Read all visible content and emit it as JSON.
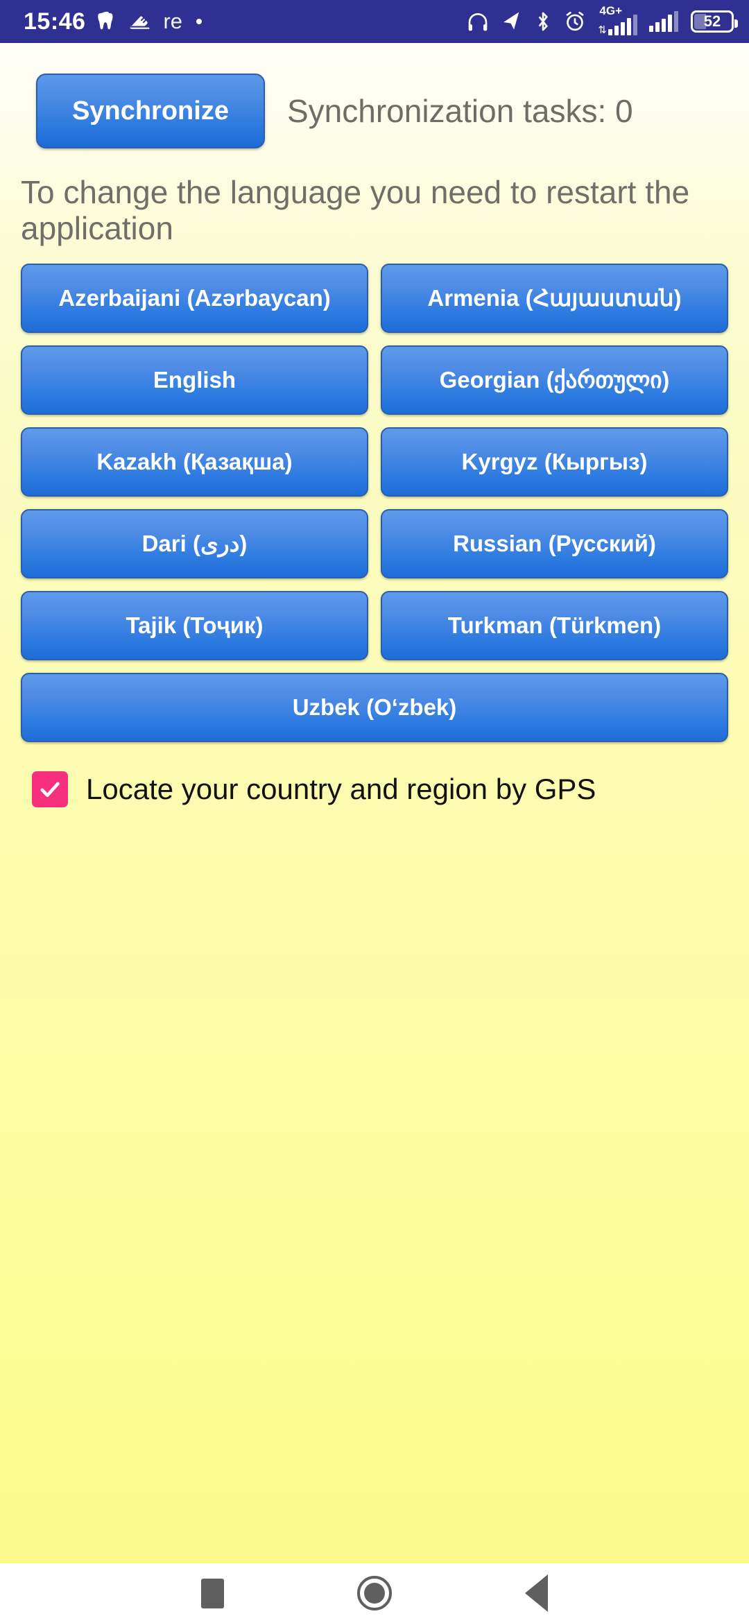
{
  "status_bar": {
    "clock": "15:46",
    "notification_text": "re",
    "left_icons": [
      "tooth-icon",
      "shoe-icon"
    ],
    "right_icons": [
      "headphones-icon",
      "location-arrow-icon",
      "bluetooth-icon",
      "alarm-clock-icon"
    ],
    "network_label": "4G+",
    "battery_level": "52",
    "background_color": "#2e3192"
  },
  "toolbar": {
    "sync_label": "Synchronize",
    "sync_tasks_text": "Synchronization tasks: 0"
  },
  "hint": {
    "text": "To change the language you need to restart the application"
  },
  "languages": {
    "items": [
      {
        "label": "Azerbaijani (Azərbaycan)",
        "name": "language-button-azerbaijani",
        "full_width": false
      },
      {
        "label": "Armenia (Հայաստան)",
        "name": "language-button-armenia",
        "full_width": false
      },
      {
        "label": "English",
        "name": "language-button-english",
        "full_width": false
      },
      {
        "label": "Georgian (ქართული)",
        "name": "language-button-georgian",
        "full_width": false
      },
      {
        "label": "Kazakh (Қазақша)",
        "name": "language-button-kazakh",
        "full_width": false
      },
      {
        "label": "Kyrgyz (Кыргыз)",
        "name": "language-button-kyrgyz",
        "full_width": false
      },
      {
        "label": "Dari (دری)",
        "name": "language-button-dari",
        "full_width": false
      },
      {
        "label": "Russian (Русский)",
        "name": "language-button-russian",
        "full_width": false
      },
      {
        "label": "Tajik (Тоҷик)",
        "name": "language-button-tajik",
        "full_width": false
      },
      {
        "label": "Turkman (Türkmen)",
        "name": "language-button-turkman",
        "full_width": false
      },
      {
        "label": "Uzbek (O‘zbek)",
        "name": "language-button-uzbek",
        "full_width": true
      }
    ]
  },
  "gps_option": {
    "label": "Locate your country and region by GPS",
    "checked": true,
    "checkbox_color": "#f6307c"
  },
  "nav_bar": {
    "items": [
      "recents-button",
      "home-button",
      "back-button"
    ]
  },
  "colors": {
    "status_bar": "#2e3192",
    "button_blue_top": "#5f9aea",
    "button_blue_bottom": "#1e6cd7",
    "page_background_top": "#fffffb",
    "page_background_bottom": "#fafa8c",
    "hint_text": "#6f6f68"
  }
}
